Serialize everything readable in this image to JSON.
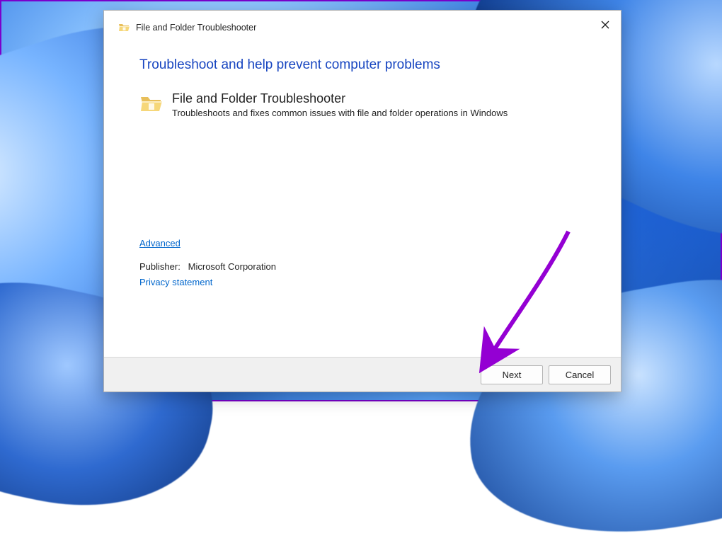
{
  "header": {
    "title": "File and Folder Troubleshooter"
  },
  "main": {
    "heading": "Troubleshoot and help prevent computer problems",
    "item": {
      "title": "File and Folder Troubleshooter",
      "description": "Troubleshoots and fixes common issues with file and folder operations in Windows"
    },
    "advanced": "Advanced",
    "publisher_label": "Publisher:",
    "publisher_value": "Microsoft Corporation",
    "privacy": "Privacy statement"
  },
  "footer": {
    "next": "Next",
    "cancel": "Cancel"
  },
  "icons": {
    "close": "close-icon",
    "folder": "folder-open-icon"
  },
  "annotation": {
    "arrow_color": "#9400D3"
  }
}
